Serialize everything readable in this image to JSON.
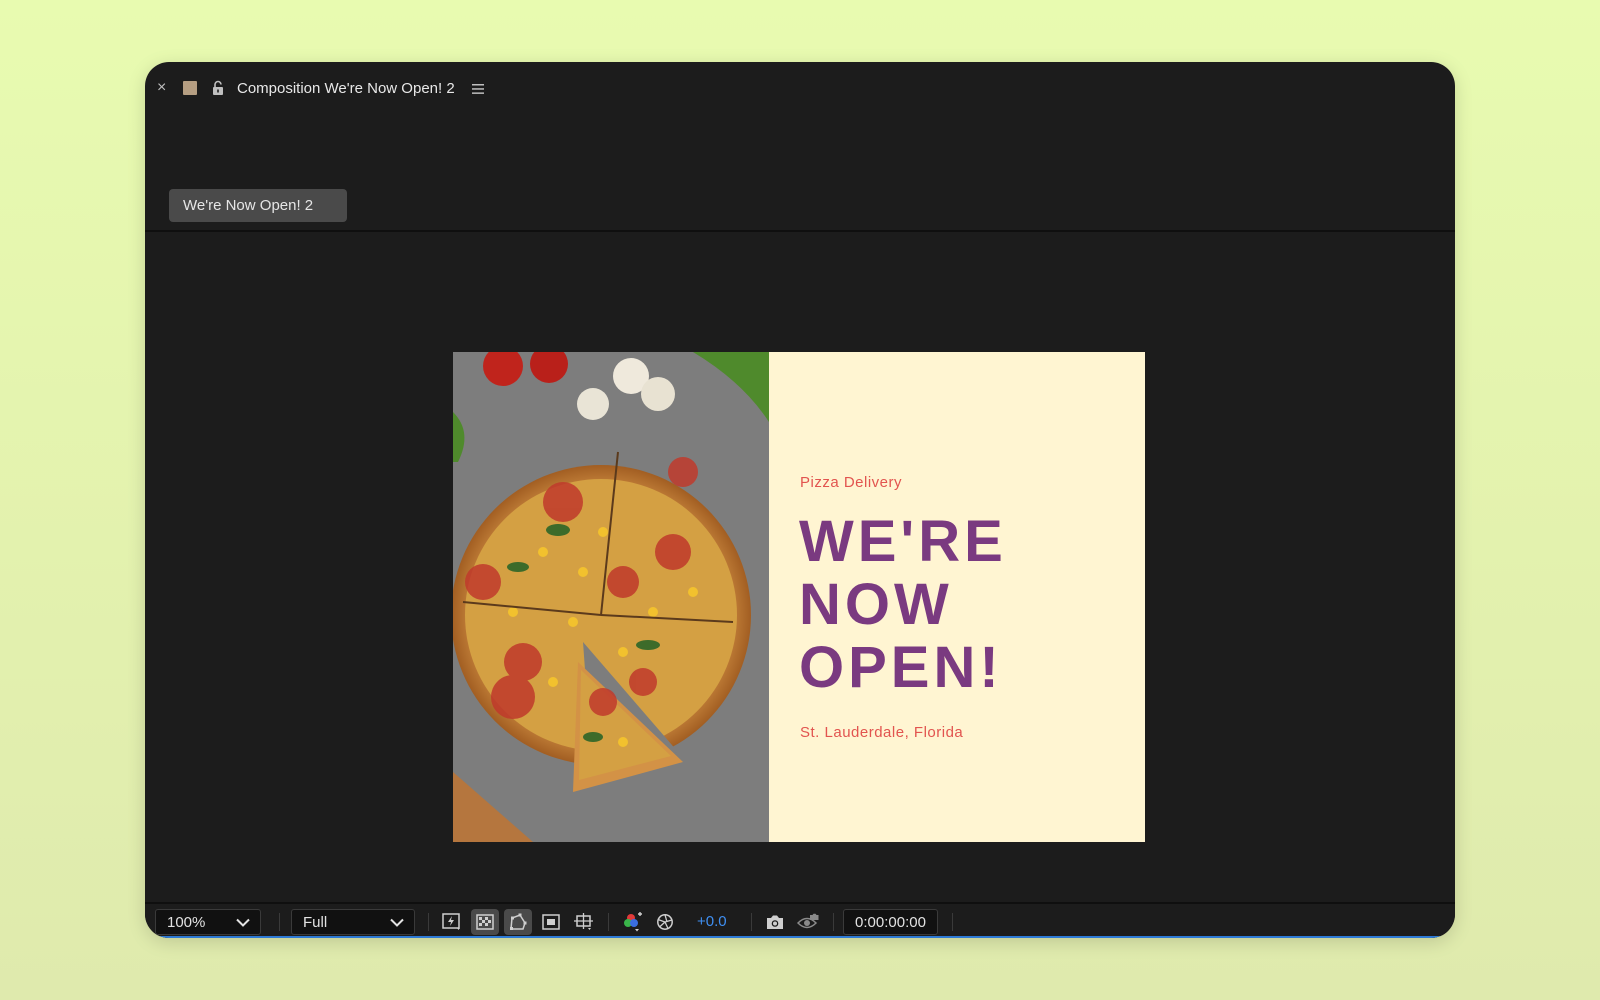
{
  "panel": {
    "close_glyph": "×",
    "title": "Composition We're Now Open! 2",
    "swatch_color": "#b59e82"
  },
  "tab": {
    "label": "We're Now Open! 2"
  },
  "composition": {
    "eyebrow": "Pizza Delivery",
    "headline": "WE'RE\nNOW\nOPEN!",
    "location": "St. Lauderdale, Florida",
    "image_subject": "pizza-photo",
    "colors": {
      "card": "#fff5d2",
      "headline": "#7a3a80",
      "accent": "#e2544f"
    }
  },
  "toolbar": {
    "zoom": "100%",
    "resolution": "Full",
    "exposure": "+0.0",
    "timecode": "0:00:00:00",
    "icons": [
      "fast-previews-icon",
      "transparency-grid-icon",
      "mask-path-icon",
      "region-of-interest-icon",
      "guides-icon",
      "color-channels-icon",
      "reset-exposure-icon",
      "snapshot-icon",
      "show-snapshot-icon"
    ]
  }
}
